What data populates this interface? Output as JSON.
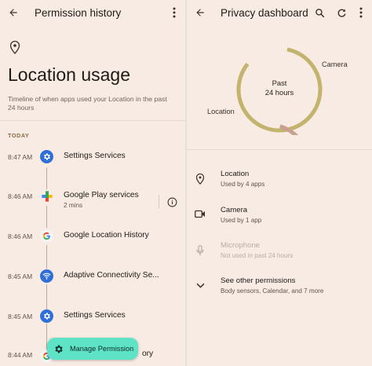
{
  "left": {
    "appbar_title": "Permission history",
    "title": "Location usage",
    "subtitle": "Timeline of when apps used your Location in the past 24 hours",
    "section": "TODAY",
    "entries": [
      {
        "time": "8:47 AM",
        "name": "Settings Services",
        "sub": "",
        "icon": "settings-services-icon"
      },
      {
        "time": "8:46 AM",
        "name": "Google Play services",
        "sub": "2 mins",
        "icon": "google-play-services-icon"
      },
      {
        "time": "8:46 AM",
        "name": "Google Location History",
        "sub": "",
        "icon": "google-g-icon"
      },
      {
        "time": "8:45 AM",
        "name": "Adaptive Connectivity Se...",
        "sub": "",
        "icon": "adaptive-connectivity-icon"
      },
      {
        "time": "8:45 AM",
        "name": "Settings Services",
        "sub": "",
        "icon": "settings-services-icon"
      },
      {
        "time": "8:44 AM",
        "name": "ory",
        "sub": "",
        "icon": "google-g-icon"
      }
    ],
    "fab_label": "Manage Permission"
  },
  "right": {
    "appbar_title": "Privacy dashboard",
    "donut": {
      "center_line1": "Past",
      "center_line2": "24 hours",
      "label_camera": "Camera",
      "label_location": "Location",
      "location_color": "#c2b46c",
      "camera_color": "#c9a090"
    },
    "permissions": [
      {
        "title": "Location",
        "sub": "Used by 4 apps",
        "icon": "location-pin-icon",
        "disabled": false
      },
      {
        "title": "Camera",
        "sub": "Used by 1 app",
        "icon": "camera-icon",
        "disabled": false
      },
      {
        "title": "Microphone",
        "sub": "Not used in past 24 hours",
        "icon": "microphone-icon",
        "disabled": true
      },
      {
        "title": "See other permissions",
        "sub": "Body sensors, Calendar, and 7 more",
        "icon": "chevron-down-icon",
        "disabled": false
      }
    ]
  }
}
